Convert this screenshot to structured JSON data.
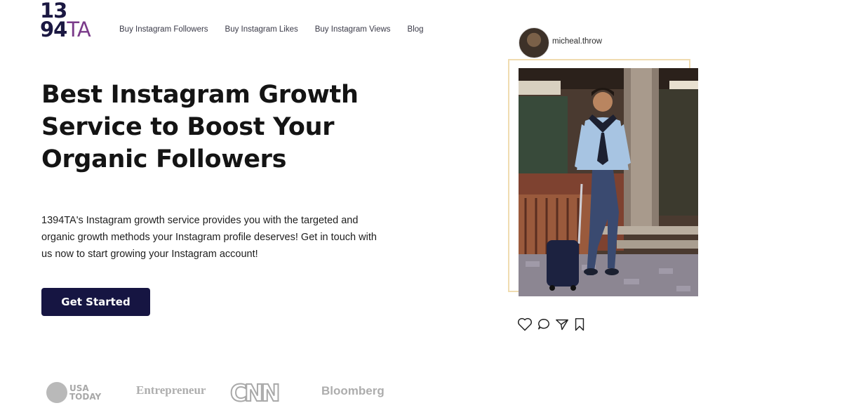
{
  "logo": {
    "line1": "13",
    "line2_digits": "94",
    "line2_letters": "TA"
  },
  "nav": {
    "items": [
      {
        "label": "Buy Instagram Followers"
      },
      {
        "label": "Buy Instagram Likes"
      },
      {
        "label": "Buy Instagram Views"
      },
      {
        "label": "Blog"
      }
    ]
  },
  "hero": {
    "headline": "Best Instagram Growth Service to Boost Your Organic Followers",
    "description": "1394TA's Instagram growth service provides you with the targeted and organic growth methods your Instagram profile deserves! Get in touch with us now to start growing your Instagram account!",
    "cta_label": "Get Started"
  },
  "press": {
    "usa_today": "USA TODAY",
    "entrepreneur": "Entrepreneur",
    "cnn": "CNN",
    "bloomberg": "Bloomberg"
  },
  "post": {
    "username": "micheal.throw",
    "icons": [
      "heart-icon",
      "comment-icon",
      "share-icon",
      "bookmark-icon"
    ]
  },
  "colors": {
    "brand_navy": "#161542",
    "logo_purple": "#7a3b8a",
    "frame_border": "#f0dcb0",
    "press_gray": "#a9a9a9"
  }
}
